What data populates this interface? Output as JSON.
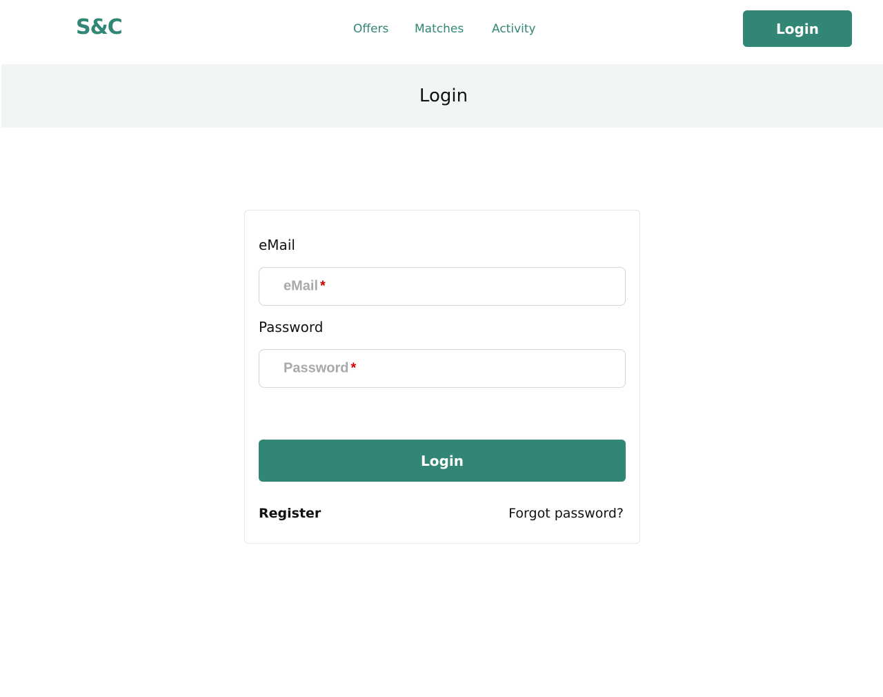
{
  "header": {
    "brand": "S&C",
    "nav": [
      {
        "label": "Offers"
      },
      {
        "label": "Matches"
      },
      {
        "label": "Activity"
      }
    ],
    "login_button": "Login"
  },
  "page": {
    "title": "Login"
  },
  "form": {
    "email": {
      "label": "eMail",
      "placeholder": "eMail",
      "required_mark": "*",
      "value": ""
    },
    "password": {
      "label": "Password",
      "placeholder": "Password",
      "required_mark": "*",
      "value": ""
    },
    "submit_label": "Login",
    "register_link": "Register",
    "forgot_link": "Forgot password?"
  },
  "colors": {
    "brand": "#318675",
    "title_band": "#f1f5f6",
    "required": "#d40000",
    "placeholder": "#a9a9a9"
  }
}
